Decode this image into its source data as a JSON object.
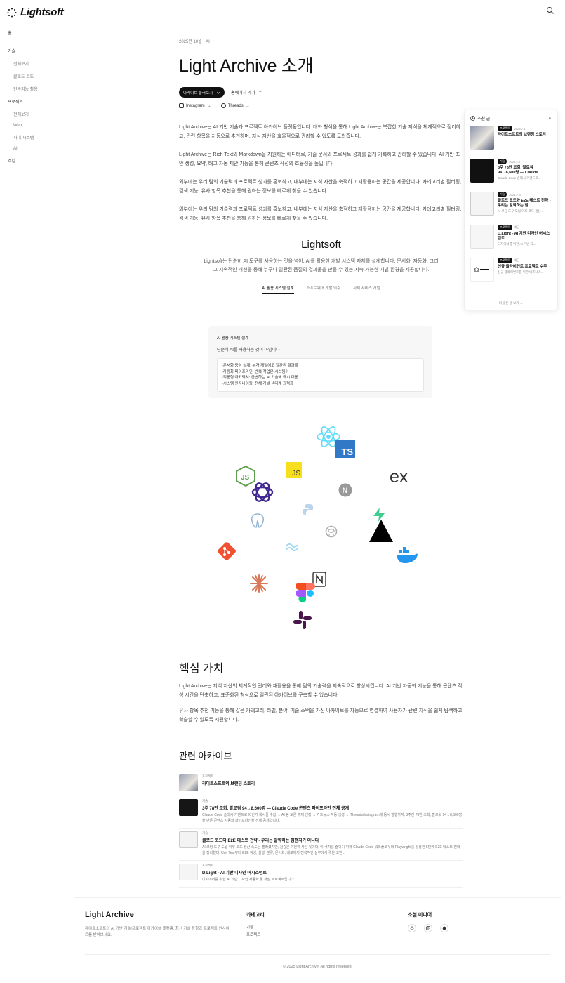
{
  "header": {
    "brand": "Lightsoft",
    "search_icon": "search-icon"
  },
  "sidebar": {
    "home": "홈",
    "groups": [
      {
        "label": "기술",
        "items": [
          "전체보기",
          "클로드 코드",
          "인공지능 활용"
        ]
      },
      {
        "label": "프로젝트",
        "items": [
          "전체보기",
          "Web",
          "사내 시스템",
          "AI"
        ]
      }
    ],
    "quotes": "스킬"
  },
  "article": {
    "meta": "2025년 10월 · AI",
    "title": "Light Archive 소개",
    "archive_button": "아카이브 둘러보기",
    "home_link": "홈페이지 가기",
    "home_arrow": "→",
    "instagram": "Instagram",
    "threads": "Threads",
    "social_arrow": "→",
    "paragraphs": [
      "Light Archive는 AI 기반 기술과 프로젝트 아카이브 플랫폼입니다. 대화 형식을 통해 Light Archive는 복잡한 기술 지식을 체계적으로 정리하고, 관련 항목을 자동으로 추천하며, 지식 자산을 효율적으로 관리할 수 있도록 도와줍니다.",
      "Light Archive는 Rich Text와 Markdown을 지원하는 에디터로, 기술 문서와 프로젝트 성과를 쉽게 기록하고 관리할 수 있습니다. AI 기반 초안 생성, 요약, 태그 자동 제안 기능을 통해 콘텐츠 작성의 효율성을 높입니다.",
      "외부에는 우리 팀의 기술력과 프로젝트 성과를 홍보하고, 내부에는 지식 자산을 축적하고 재활용하는 공간을 제공합니다. 카테고리별 필터링, 검색 기능, 유사 항목 추천을 통해 원하는 정보를 빠르게 찾을 수 있습니다.",
      "외부에는 우리 팀의 기술력과 프로젝트 성과를 홍보하고, 내부에는 지식 자산을 축적하고 재활용하는 공간을 제공합니다. 카테고리별 필터링, 검색 기능, 유사 항목 추천을 통해 원하는 정보를 빠르게 찾을 수 있습니다."
    ]
  },
  "lightsoft": {
    "title": "Lightsoft",
    "description": "Lightsoft는 단순히 AI 도구를 사용하는 것을 넘어, AI를 활용한 개발 시스템 자체를 설계합니다. 문서화, 자동화, 그리고 지속적인 개선을 통해 누구나 일관된 품질의 결과물을 만들 수 있는 지속 가능한 개발 환경을 제공합니다.",
    "tabs": [
      "AI 활용 시스템 설계",
      "소프트웨어 개발 외주",
      "자체 서비스 개발"
    ],
    "card": {
      "heading": "AI 활용 시스템 설계",
      "subheading": "단순히 AI를 사용하는 것이 아닙니다",
      "lines": [
        "-문서화 중심 설계: 누가 개발해도 일관된 결과물",
        "-자동화 파이프라인: 반복 작업은 시스템이",
        "-적응형 아키텍처: 급변하는 AI 기술에 즉시 대응",
        "-시스템 엔지니어링: 전체 개발 생태계 최적화"
      ]
    },
    "icons": [
      "react-icon",
      "typescript-icon",
      "nodejs-icon",
      "javascript-icon",
      "openai-icon",
      "nextjs-icon",
      "express-icon",
      "postgresql-icon",
      "python-icon",
      "github-icon",
      "supabase-icon",
      "vercel-icon",
      "git-icon",
      "tailwind-icon",
      "docker-icon",
      "claude-icon",
      "notion-icon",
      "figma-icon",
      "slack-icon"
    ],
    "icon_text": {
      "ts": "TS",
      "js": "JS",
      "ex": "ex"
    }
  },
  "core": {
    "title": "핵심 가치",
    "paragraphs": [
      "Light Archive는 지식 자산의 체계적인 관리와 재활용을 통해 팀의 기술력을 지속적으로 향상시킵니다. AI 기반 자동화 기능을 통해 콘텐츠 작성 시간을 단축하고, 표준화된 형식으로 일관된 아카이브를 구축할 수 있습니다.",
      "유사 항목 추천 기능을 통해 같은 카테고리, 라벨, 분야, 기술 스택을 가진 아카이브를 자동으로 연결하여 사용자가 관련 지식을 쉽게 탐색하고 학습할 수 있도록 지원합니다."
    ]
  },
  "related": {
    "title": "관련 아카이브",
    "items": [
      {
        "category": "프로젝트",
        "title": "라이트소프트의 브랜딩 스토리",
        "desc": ""
      },
      {
        "category": "기술",
        "title": "3주 78만 조회, 팔로워 94→8,600명 — Claude Code 콘텐츠 파이프라인 전체 공개",
        "desc": "Claude Code 슬래시 커맨드로 X 인기 게시물 수집 → AI 팀 토론 주제 선정 → 카드뉴스 자동 생성 → Threads/Instagram에 동시 발행까지. 3주간 78만 조회, 팔로워 94→8,600명을 만든 콘텐츠 자동화 파이프라인을 전체 공개합니다."
      },
      {
        "category": "기술",
        "title": "클로드 코드와 E2E 테스트 전략 - 우리는 말학하는 침팬지가 아니다",
        "desc": "AI 코딩 도구 도입 이후 코드 생산 속도는 빨라졌지만, 검증은 여전히 사람 몫이다. 이 격차를 줄이기 위해 Claude Code 워크플로우와 Playwright를 활용한 5단계 E2E 테스트 전략을 정리했다. Unit Test부터 E2E 작성, 실행, 분류, 문서화, 배포까지 전략적인 실무에서 겪은 고민..."
      },
      {
        "category": "프로젝트",
        "title": "D.Light - AI 기반 디자인 어시스턴트",
        "desc": "디자이너를 위한 AI 기반 디자인 자동화 툴 개발 프로젝트입니다."
      }
    ]
  },
  "panel": {
    "title": "추천 글",
    "close": "×",
    "items": [
      {
        "badge": "프로젝트",
        "date": "2026.7.6",
        "title": "라이트소프트의 브랜딩 스토리",
        "desc": ""
      },
      {
        "badge": "기술",
        "date": "2026.4.9",
        "title": "3주 78만 조회, 팔로워 94→8,600명 — Claude...",
        "desc": "Claude Code 슬래시 커맨드로..."
      },
      {
        "badge": "기술",
        "date": "2026.2.25",
        "title": "클로드 코드와 E2E 테스트 전략 - 우리는 말학하는 침...",
        "desc": "AI 코딩 도구 도입 이후 코드 생산..."
      },
      {
        "badge": "프로젝트",
        "date": "최근",
        "title": "D.Light - AI 기반 디자인 어시스턴트",
        "desc": "디자이너를 위한 AI 기반 디..."
      },
      {
        "badge": "프로젝트",
        "date": "최근",
        "title": "신규 클라이언트 프로젝트 수주",
        "desc": "신규 클라이언트를 위한 비즈니스..."
      }
    ],
    "more": "더 많은 글 보기 →"
  },
  "footer": {
    "brand": "Light Archive",
    "desc": "라이트소프트의 AI 기반 기술/프로젝트 아카이브 플랫폼. 최신 기술 동향과 프로젝트 인사이트를 받아보세요.",
    "cat_title": "카테고리",
    "cat_items": [
      "기술",
      "프로젝트"
    ],
    "social_title": "소셜 미디어",
    "social_icons": [
      "threads-icon",
      "instagram-icon",
      "github-icon"
    ],
    "copyright": "© 2025 Light Archive. All rights reserved."
  }
}
